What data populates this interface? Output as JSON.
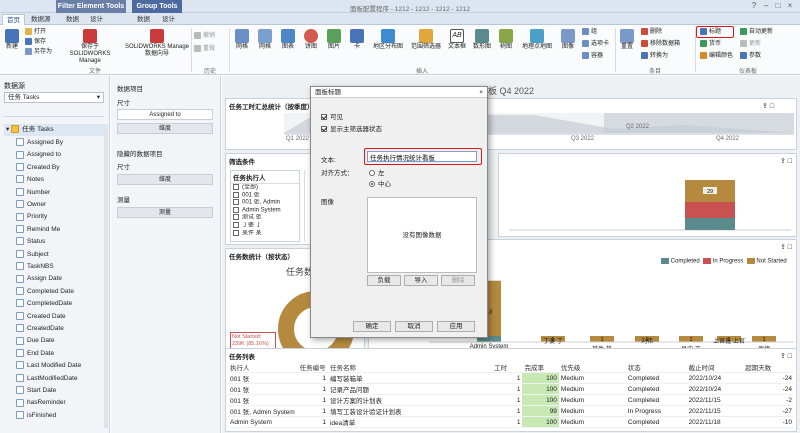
{
  "titlebar": {
    "ctx_filter": "Filter Element Tools",
    "ctx_group": "Group Tools",
    "app_title": "面板配置程序 - 1212 - 1212 - 1212 - 1212"
  },
  "tabs": [
    "首页",
    "数据源",
    "数据",
    "设计",
    "数据",
    "设计"
  ],
  "ribbon": {
    "new": "新建",
    "open": "打开",
    "save": "保存",
    "save_as": "另存为",
    "save_sw": "保存于 SOLIDWORKS Manage",
    "sw_wizard": "SOLIDWORKS Manage 数据向导",
    "undo": "撤销",
    "redo": "重做",
    "items": [
      "网格",
      "网格",
      "图表",
      "饼图",
      "图片",
      "卡",
      "地区分布图",
      "范围筛选器",
      "文本框",
      "数形图",
      "树图",
      "地理点地图",
      "图像"
    ],
    "small": [
      "组",
      "选项卡",
      "容器"
    ],
    "refresh": "重置",
    "delete": "删除",
    "remove_source": "移除数据箱",
    "convert": "转换为",
    "title_btn": "标题",
    "currency": "货币",
    "edit_colors": "编辑颜色",
    "auto_update": "自动更新",
    "update": "更新",
    "params": "参数",
    "group_file": "文件",
    "group_history": "历史",
    "group_insert": "插入",
    "group_items": "条目",
    "group_dashboard": "仪表板"
  },
  "left": {
    "header": "数据源",
    "source": "任务 Tasks",
    "root": "任务 Tasks",
    "fields": [
      "Assigned By",
      "Assigned to",
      "Created By",
      "Notes",
      "Number",
      "Owner",
      "Priority",
      "Remind Me",
      "Status",
      "Subject",
      "TaskNBS",
      "Assign Date",
      "Completed Date",
      "CompletedDate",
      "Created Date",
      "CreatedDate",
      "Due Date",
      "End Date",
      "Last Modified Date",
      "LastModifiedDate",
      "Start Date",
      "hasReminder",
      "isFinished"
    ]
  },
  "mid": {
    "data_items": "数据项目",
    "dimensions": "尺寸",
    "assigned_to": "Assigned to",
    "dimension_btn": "维度",
    "hidden": "隐藏的数据项目",
    "dim2": "尺寸",
    "dim2_btn": "维度",
    "measures": "测量",
    "measure_btn": "测量"
  },
  "canvas": {
    "dash_title": "仪表板  Q4 2022",
    "panel1_title": "任务工时汇总统计（按季度）",
    "range_labels": [
      "Q1 2022",
      "Q2 2022",
      "Q3 2022",
      "Q4 2022"
    ],
    "filter_title": "筛选条件",
    "filter_owner": "任务执行人",
    "filter_items": [
      "(全部)",
      "001 张",
      "001 张, Admin",
      "Admin System",
      "测试 张",
      "丁婆 丁",
      "某件 某"
    ],
    "pie_panel": "任务数统计（按状态）",
    "pie_subtitle": "任务数",
    "pie_callout": "Not Started: 239K (85.16%)",
    "legend": [
      "Completed",
      "In Progress",
      "Not Started"
    ],
    "bar_top_value": "29",
    "bar_values": [
      "13",
      "1",
      "1",
      "1",
      "1",
      "1",
      "1"
    ],
    "bar_categories": [
      "Admin System",
      "丁婆 丁",
      "某件 某",
      "刘伟",
      "吕中 正",
      "上官鑫 上官",
      "周捷"
    ],
    "table_title": "任务列表",
    "table_headers": [
      "执行人",
      "任务编号",
      "任务名称",
      "工时",
      "完成率",
      "优先级",
      "状态",
      "截止时间",
      "超期天数"
    ],
    "rows": [
      [
        "001 张",
        "1",
        "编写装箱单",
        "1",
        "100",
        "Medium",
        "Completed",
        "2022/10/24",
        "-24"
      ],
      [
        "001 张",
        "1",
        "记录产品问题",
        "1",
        "100",
        "Medium",
        "Completed",
        "2022/10/24",
        "-24"
      ],
      [
        "001 张",
        "1",
        "设计方案的计划表",
        "1",
        "100",
        "Medium",
        "Completed",
        "2022/11/15",
        "-2"
      ],
      [
        "001 张, Admin System",
        "1",
        "填写工装设计验证计划表",
        "1",
        "99",
        "Medium",
        "In Progress",
        "2022/11/15",
        "-27"
      ],
      [
        "Admin System",
        "1",
        "idea清单",
        "1",
        "100",
        "Medium",
        "Completed",
        "2022/11/18",
        "-10"
      ]
    ]
  },
  "dialog": {
    "title": "面板标题",
    "visible": "可见",
    "show_filter": "显示主筛选器状态",
    "text_label": "文本:",
    "text_value": "任务执行情况统计看板",
    "align_label": "对齐方式：",
    "align_left": "左",
    "align_center": "中心",
    "image_label": "图像",
    "no_image": "没有图像数据",
    "load": "负载",
    "import": "导入",
    "delete": "删除",
    "ok": "确定",
    "cancel": "取消",
    "apply": "应用"
  },
  "colors": {
    "completed": "#5b8a8c",
    "in_progress": "#c9514f",
    "not_started": "#b58a3f",
    "ribbon_accent": "#1d4d99",
    "highlight": "#e01515"
  }
}
